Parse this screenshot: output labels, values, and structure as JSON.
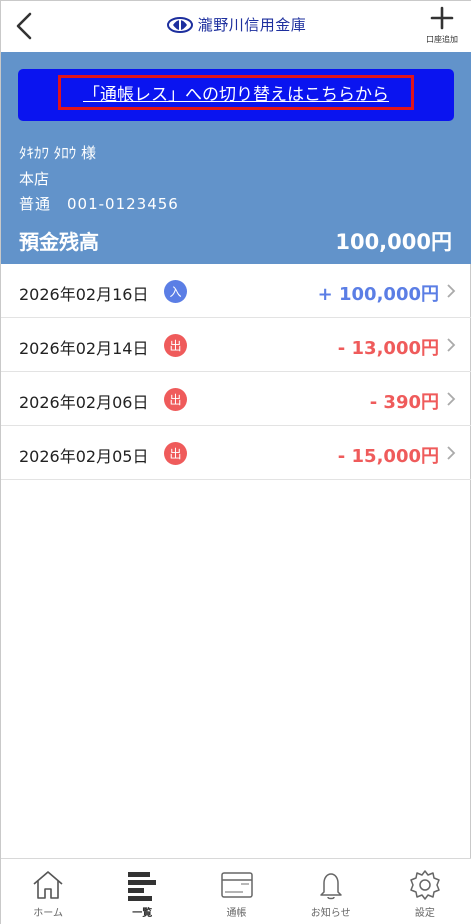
{
  "header": {
    "bank_name": "瀧野川信用金庫",
    "add_account_label": "口座追加"
  },
  "banner": {
    "passbookless_link": "「通帳レス」への切り替えはこちらから"
  },
  "account": {
    "holder_name": "ﾀｷｶﾜ ﾀﾛｳ 様",
    "branch": "本店",
    "number": "普通　001-0123456",
    "balance_label": "預金残高",
    "balance": "100,000円",
    "colors": {
      "panel": "#6293ca",
      "banner": "#0a14f0",
      "banner_border": "#e0141b"
    }
  },
  "transactions": [
    {
      "date": "2026年02月16日",
      "type": "in",
      "badge": "入",
      "amount": "+ 100,000円"
    },
    {
      "date": "2026年02月14日",
      "type": "out",
      "badge": "出",
      "amount": "- 13,000円"
    },
    {
      "date": "2026年02月06日",
      "type": "out",
      "badge": "出",
      "amount": "- 390円"
    },
    {
      "date": "2026年02月05日",
      "type": "out",
      "badge": "出",
      "amount": "- 15,000円"
    }
  ],
  "tabbar": {
    "tabs": [
      {
        "label": "ホーム",
        "icon": "home-icon"
      },
      {
        "label": "一覧",
        "icon": "list-icon",
        "active": true
      },
      {
        "label": "通帳",
        "icon": "passbook-icon"
      },
      {
        "label": "お知らせ",
        "icon": "bell-icon"
      },
      {
        "label": "設定",
        "icon": "gear-icon"
      }
    ]
  },
  "colors": {
    "income": "#5b7ee5",
    "expense": "#ef5b5b"
  }
}
